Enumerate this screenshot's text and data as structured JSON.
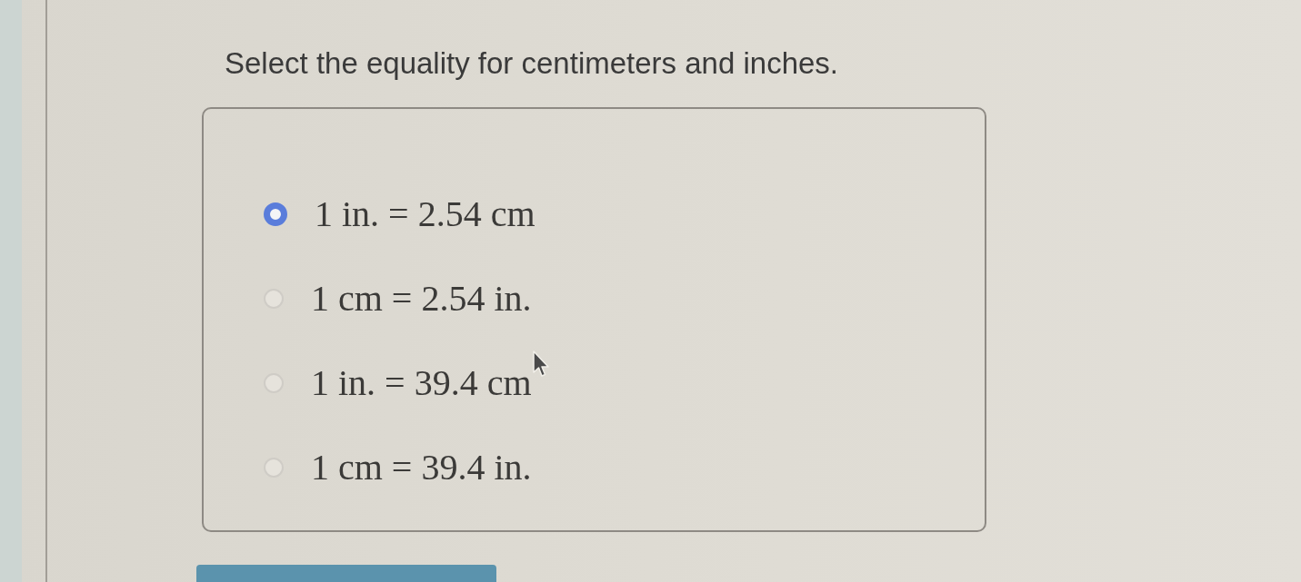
{
  "question": {
    "text": "Select the equality for centimeters and inches."
  },
  "options": [
    {
      "label": "1 in. = 2.54 cm",
      "selected": true
    },
    {
      "label": "1 cm = 2.54 in.",
      "selected": false
    },
    {
      "label": "1 in. = 39.4 cm",
      "selected": false
    },
    {
      "label": "1 cm = 39.4 in.",
      "selected": false
    }
  ]
}
